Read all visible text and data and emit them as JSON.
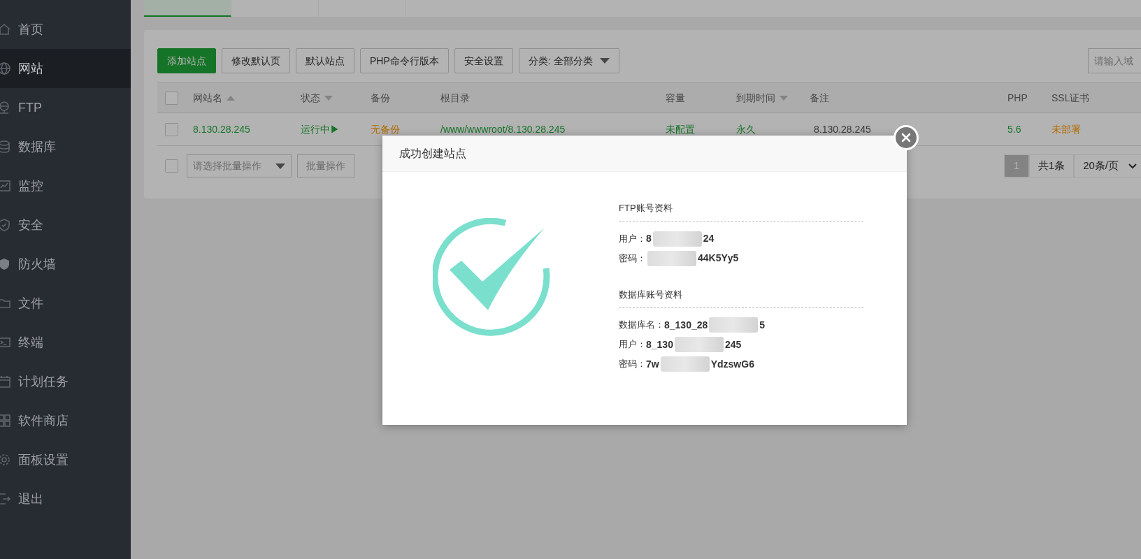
{
  "sidebar": {
    "items": [
      {
        "label": "首页",
        "selected": false
      },
      {
        "label": "网站",
        "selected": true
      },
      {
        "label": "FTP",
        "selected": false
      },
      {
        "label": "数据库",
        "selected": false
      },
      {
        "label": "监控",
        "selected": false
      },
      {
        "label": "安全",
        "selected": false
      },
      {
        "label": "防火墙",
        "selected": false
      },
      {
        "label": "文件",
        "selected": false
      },
      {
        "label": "终端",
        "selected": false
      },
      {
        "label": "计划任务",
        "selected": false
      },
      {
        "label": "软件商店",
        "selected": false
      },
      {
        "label": "面板设置",
        "selected": false
      },
      {
        "label": "退出",
        "selected": false
      }
    ]
  },
  "tabs": [
    {
      "selected": true
    },
    {
      "selected": false
    },
    {
      "selected": false
    }
  ],
  "toolbar": {
    "buttons": [
      {
        "label": "添加站点",
        "kind": "primary"
      },
      {
        "label": "修改默认页",
        "kind": "default"
      },
      {
        "label": "默认站点",
        "kind": "default"
      },
      {
        "label": "PHP命令行版本",
        "kind": "default"
      },
      {
        "label": "安全设置",
        "kind": "default"
      },
      {
        "label": "分类: 全部分类",
        "kind": "dropdown"
      }
    ],
    "search": {
      "placeholder": "请输入域"
    }
  },
  "table": {
    "all_checked": false,
    "columns": [
      {
        "label": "网站名",
        "sortable": true,
        "ascending": true
      },
      {
        "label": "状态",
        "sortable": true,
        "ascending": false
      },
      {
        "label": "备份"
      },
      {
        "label": "根目录"
      },
      {
        "label": "容量"
      },
      {
        "label": "到期时间",
        "sortable": true,
        "ascending": false
      },
      {
        "label": "备注"
      },
      {
        "label": "PHP"
      },
      {
        "label": "SSL证书"
      }
    ],
    "rows": [
      {
        "checked": false,
        "cells": [
          {
            "text": "8.130.28.245",
            "color": "#167428"
          },
          {
            "text": "运行中▶",
            "color": "#167428"
          },
          {
            "text": "无备份",
            "color": "#b36b00"
          },
          {
            "text": "/www/wwwroot/8.130.28.245",
            "color": "#167428"
          },
          {
            "text": "未配置",
            "color": "#167428"
          },
          {
            "text": "永久",
            "color": "#167428"
          },
          {
            "text": "8.130.28.245",
            "color": "#3b3b3b"
          },
          {
            "text": "5.6",
            "color": "#167428"
          },
          {
            "text": "未部署",
            "color": "#b36b00"
          }
        ]
      }
    ]
  },
  "batch": {
    "checked": false,
    "placeholder": "请选择批量操作",
    "button": "批量操作"
  },
  "pagination": {
    "pages": [
      {
        "label": "1",
        "selected": true
      }
    ],
    "total": "共1条",
    "page_size": "20条/页"
  },
  "modal": {
    "title": "成功创建站点",
    "sections": [
      {
        "heading": "FTP账号资料",
        "fields": [
          {
            "label": "用户：",
            "segments": [
              {
                "kind": "text",
                "text": "8"
              },
              {
                "kind": "smear"
              },
              {
                "kind": "text",
                "text": "24"
              }
            ]
          },
          {
            "label": "密码：",
            "segments": [
              {
                "kind": "smear"
              },
              {
                "kind": "text",
                "text": "44K5Yy5"
              }
            ]
          }
        ]
      },
      {
        "heading": "数据库账号资料",
        "fields": [
          {
            "label": "数据库名：",
            "segments": [
              {
                "kind": "text",
                "text": "8_130_28"
              },
              {
                "kind": "smear"
              },
              {
                "kind": "text",
                "text": "5"
              }
            ]
          },
          {
            "label": "用户：",
            "segments": [
              {
                "kind": "text",
                "text": "8_130"
              },
              {
                "kind": "smear"
              },
              {
                "kind": "text",
                "text": "245"
              }
            ]
          },
          {
            "label": "密码：",
            "segments": [
              {
                "kind": "text",
                "text": "7w"
              },
              {
                "kind": "smear"
              },
              {
                "kind": "text",
                "text": "YdzswG6"
              }
            ]
          }
        ]
      }
    ]
  }
}
